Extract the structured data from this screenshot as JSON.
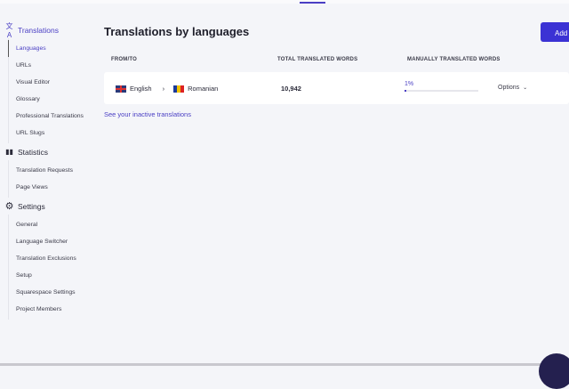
{
  "sidebar": {
    "translations": {
      "label": "Translations",
      "items": [
        "Languages",
        "URLs",
        "Visual Editor",
        "Glossary",
        "Professional Translations",
        "URL Slugs"
      ]
    },
    "statistics": {
      "label": "Statistics",
      "items": [
        "Translation Requests",
        "Page Views"
      ]
    },
    "settings": {
      "label": "Settings",
      "items": [
        "General",
        "Language Switcher",
        "Translation Exclusions",
        "Setup",
        "Squarespace Settings",
        "Project Members"
      ]
    }
  },
  "main": {
    "title": "Translations by languages",
    "add_label": "Add",
    "headers": {
      "from_to": "FROM/TO",
      "total": "TOTAL TRANSLATED WORDS",
      "manual": "MANUALLY TRANSLATED WORDS"
    },
    "row": {
      "from": "English",
      "to": "Romanian",
      "total": "10,942",
      "manual_percent": "1%",
      "manual_progress": 1,
      "options": "Options"
    },
    "inactive_link": "See your inactive translations"
  }
}
